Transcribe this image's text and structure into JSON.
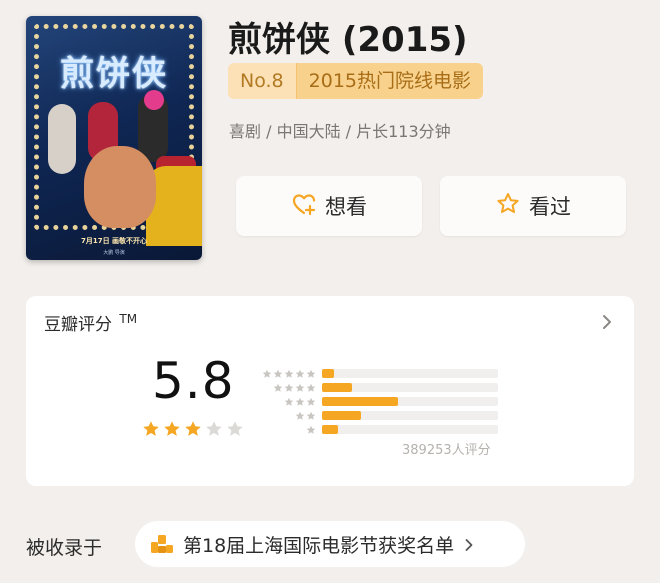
{
  "movie": {
    "title": "煎饼侠 (2015)",
    "rank_no": "No.8",
    "rank_list": "2015热门院线电影",
    "meta": "喜剧 / 中国大陆 / 片长113分钟",
    "poster": {
      "title": "煎饼侠",
      "date_text": "7月17日 画敬不开心",
      "footer_text": "大鹏 导演"
    }
  },
  "actions": {
    "want_label": "想看",
    "seen_label": "看过",
    "want_icon": "heart-plus-icon",
    "seen_icon": "star-outline-icon"
  },
  "rating": {
    "header": "豆瓣评分",
    "trademark": "TM",
    "score": "5.8",
    "stars": 3,
    "max_stars": 5,
    "count_text": "389253人评分",
    "distribution": [
      {
        "stars": 5,
        "fraction": 0.07
      },
      {
        "stars": 4,
        "fraction": 0.17
      },
      {
        "stars": 3,
        "fraction": 0.43
      },
      {
        "stars": 2,
        "fraction": 0.22
      },
      {
        "stars": 1,
        "fraction": 0.09
      }
    ]
  },
  "included": {
    "label": "被收录于",
    "item": "第18届上海国际电影节获奖名单",
    "icon": "trophy-icon"
  },
  "colors": {
    "accent": "#f5a623",
    "badge_bg": "#fbe1b5",
    "badge_text": "#b37a25",
    "page_bg": "#f3efec"
  }
}
